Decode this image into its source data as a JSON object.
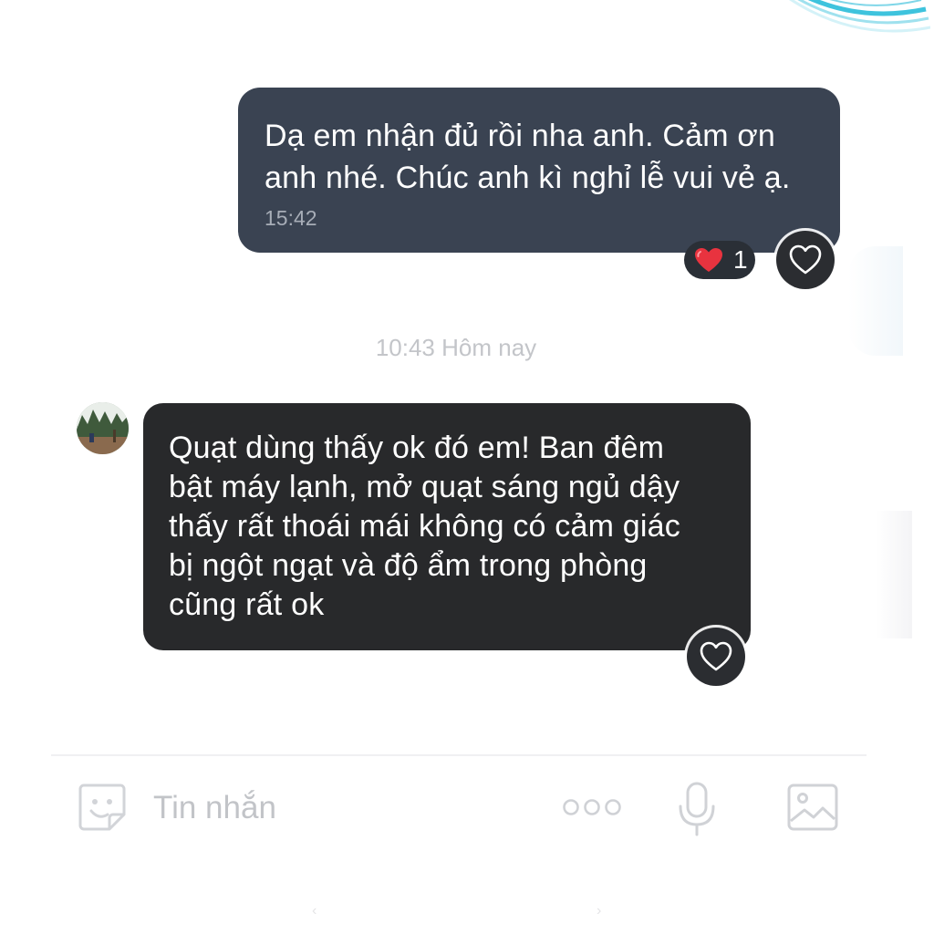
{
  "conversation": {
    "outgoing": {
      "text": "Dạ em nhận đủ rồi nha anh. Cảm ơn anh nhé. Chúc anh kì nghỉ lễ vui vẻ ạ.",
      "line1": "Dạ em nhận đủ rồi nha anh. Cảm ơn",
      "line2": "anh nhé. Chúc anh kì nghỉ lễ vui vẻ ạ.",
      "time": "15:42",
      "reaction_count": "1",
      "reaction_icon": "red-heart-icon",
      "like_icon": "heart-outline-icon"
    },
    "date_separator": "10:43 Hôm nay",
    "incoming": {
      "lines": [
        "Quạt dùng thấy ok đó em! Ban đêm",
        "bật máy lạnh, mở quạt sáng ngủ dậy",
        "thấy rất thoái mái không có cảm giác",
        "bị ngột ngạt và độ ẩm trong phòng",
        "cũng rất ok"
      ],
      "avatar_icon": "avatar-photo",
      "like_icon": "heart-outline-icon"
    }
  },
  "composer": {
    "placeholder": "Tin nhắn",
    "sticker_icon": "sticker-smiley-icon",
    "more_icon": "more-dots-icon",
    "mic_icon": "microphone-icon",
    "image_icon": "image-gallery-icon"
  },
  "nav": {
    "left_glyph": "‹",
    "right_glyph": "›"
  },
  "colors": {
    "outgoing_bubble": "#3a4352",
    "incoming_bubble": "#28292b",
    "reaction_heart": "#e8333f",
    "accent_arc": "#5ac8e0"
  }
}
